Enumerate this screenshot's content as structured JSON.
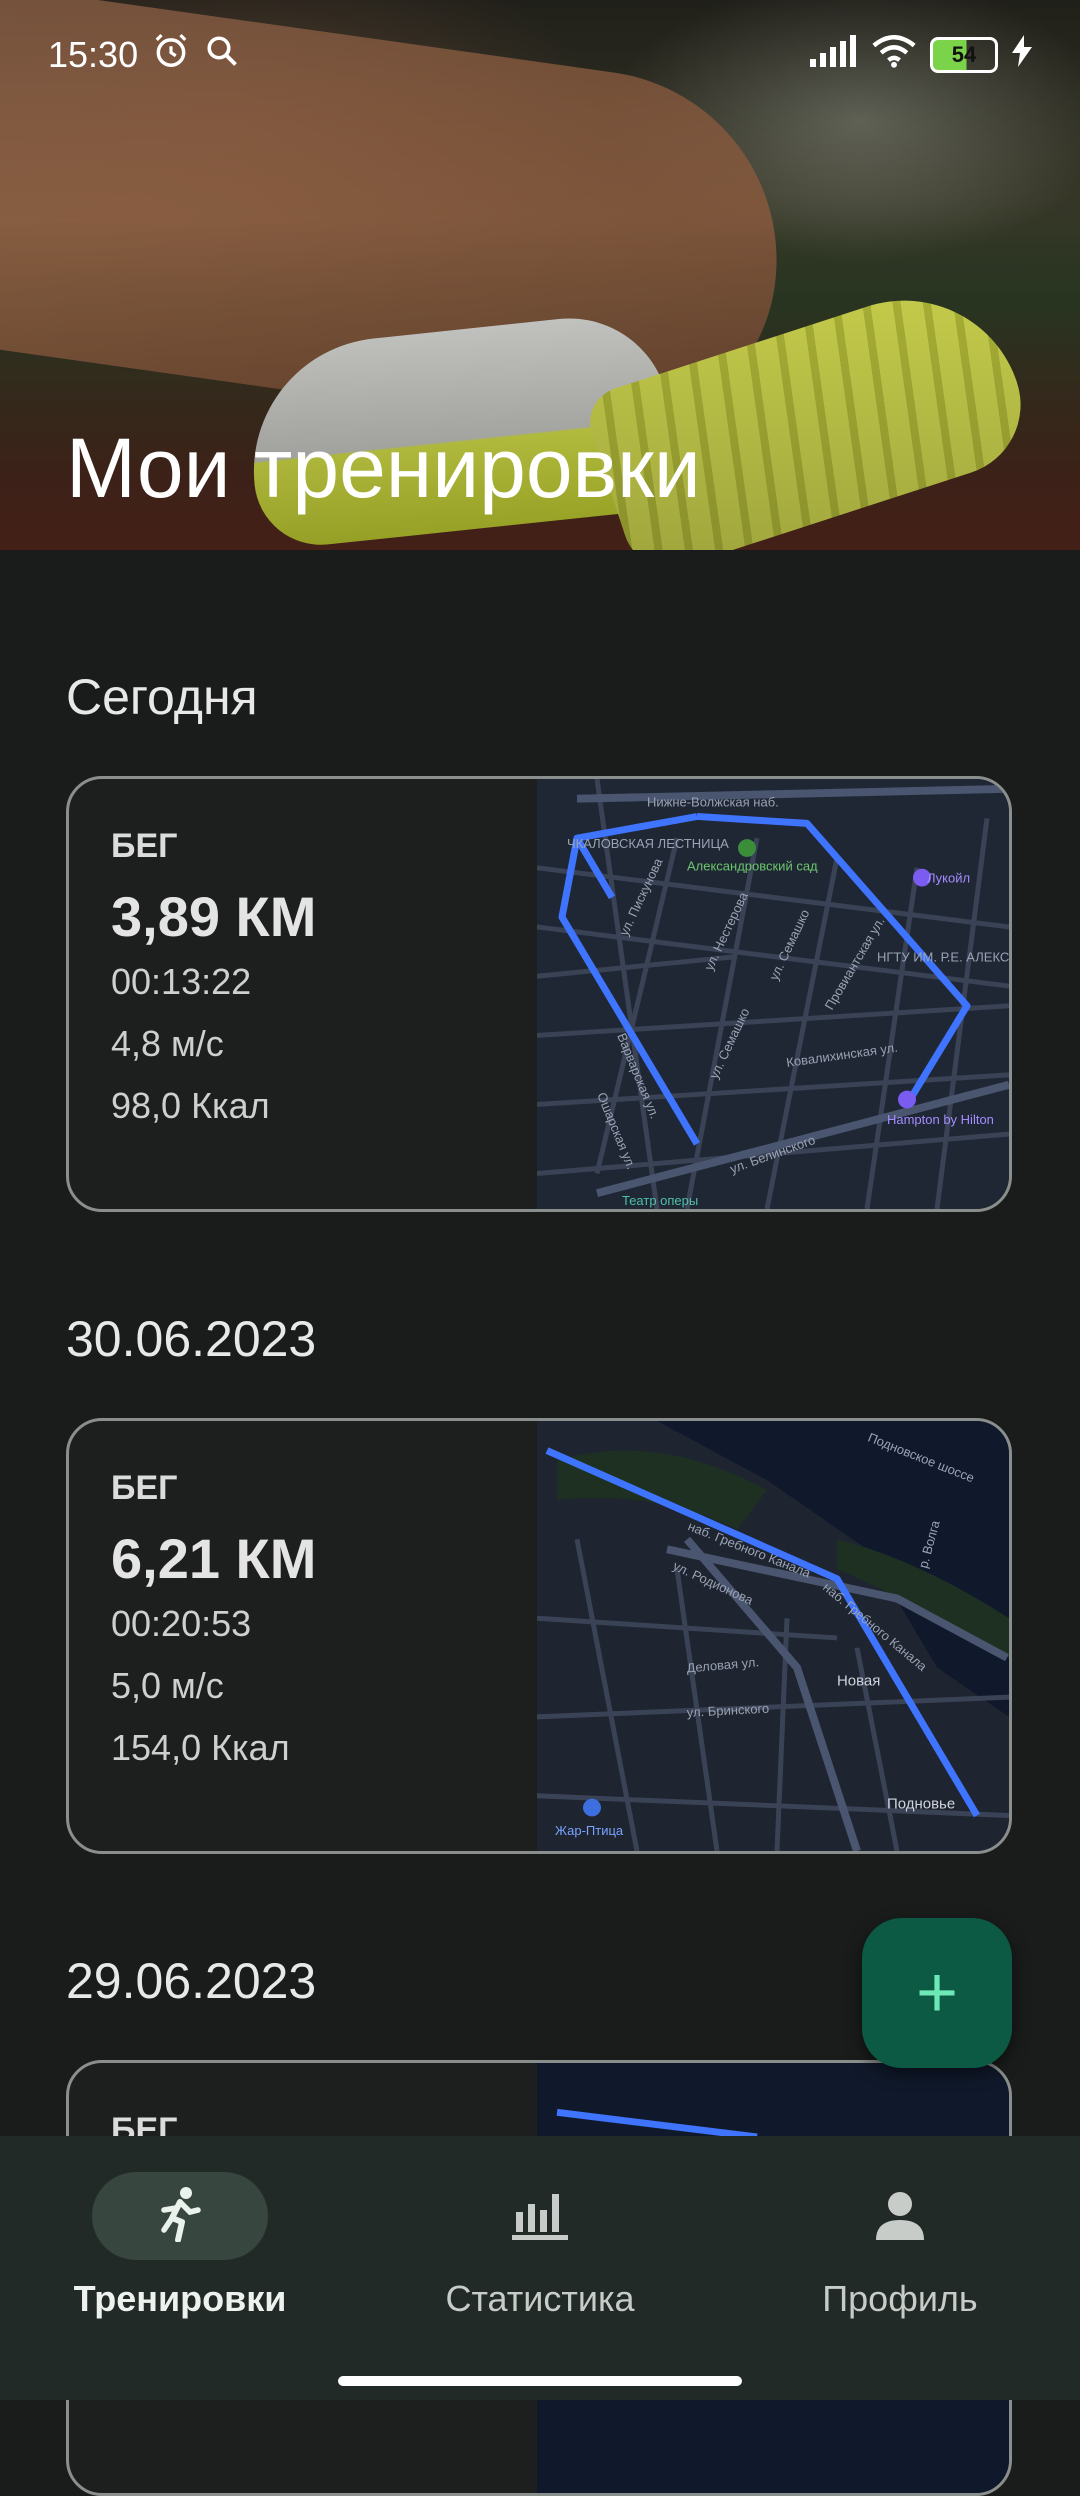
{
  "status_bar": {
    "time": "15:30",
    "battery": "54"
  },
  "header": {
    "title": "Мои тренировки"
  },
  "sections": [
    {
      "date": "Сегодня",
      "workout": {
        "type": "БЕГ",
        "distance": "3,89 КМ",
        "duration": "00:13:22",
        "speed": "4,8 м/с",
        "calories": "98,0 Ккал"
      }
    },
    {
      "date": "30.06.2023",
      "workout": {
        "type": "БЕГ",
        "distance": "6,21 КМ",
        "duration": "00:20:53",
        "speed": "5,0 м/с",
        "calories": "154,0 Ккал"
      }
    },
    {
      "date": "29.06.2023",
      "workout": {
        "type": "БЕГ"
      }
    }
  ],
  "maps": {
    "map1": {
      "streets": [
        "Нижне-Волжская наб.",
        "ул. Пискунова",
        "ул. Нестерова",
        "ул. Семашко",
        "Провиантская ул.",
        "Варварская ул.",
        "Ошарская ул.",
        "ул. Семашко",
        "Ковалихинская ул.",
        "ул. Белинского"
      ],
      "pois": [
        "ЧКАЛОВСКАЯ ЛЕСТНИЦА",
        "Александровский сад",
        "Лукойл",
        "НГТУ ИМ. Р.Е. АЛЕКСЕЕВА",
        "Hampton by Hilton",
        "Театр оперы"
      ]
    },
    "map2": {
      "streets": [
        "наб. Гребного Канала",
        "ул. Родионова",
        "ул. Бринского",
        "Деловая ул.",
        "Подновское шоссе"
      ],
      "pois": [
        "Новая",
        "Подновье",
        "Жар-Птица",
        "р. Волга"
      ]
    }
  },
  "fab": {
    "icon": "+"
  },
  "bottom_nav": [
    {
      "label": "Тренировки",
      "icon": "run-icon",
      "active": true
    },
    {
      "label": "Статистика",
      "icon": "bar-chart-icon",
      "active": false
    },
    {
      "label": "Профиль",
      "icon": "person-icon",
      "active": false
    }
  ],
  "colors": {
    "accent": "#0d5a44",
    "route": "#2e6bf0",
    "nav_bg": "#212a26"
  }
}
